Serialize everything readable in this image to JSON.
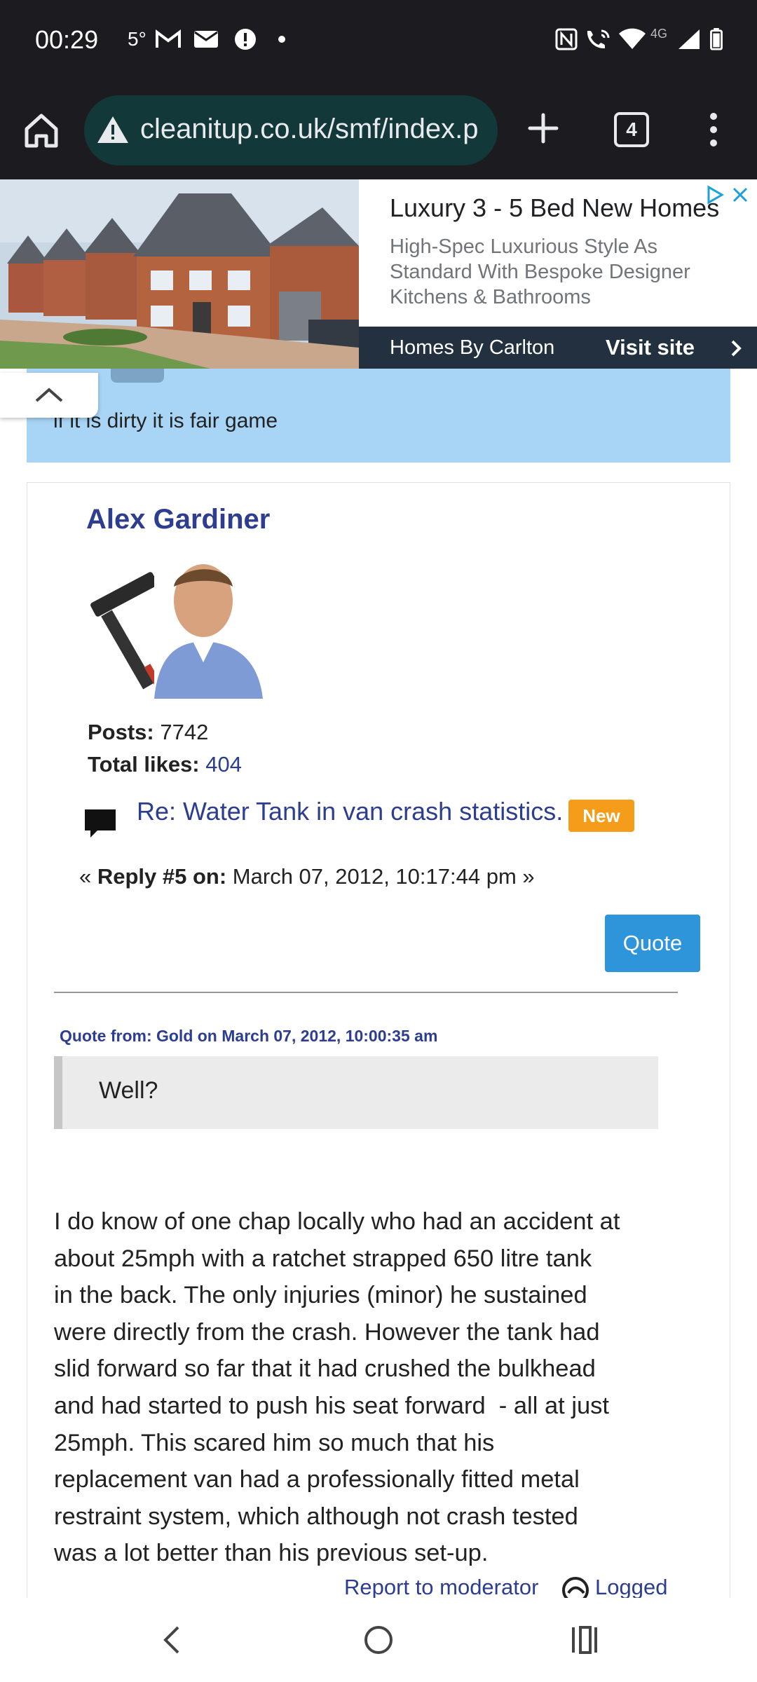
{
  "status_bar": {
    "time": "00:29",
    "temperature": "5°",
    "network": "4G"
  },
  "browser": {
    "url": "cleanitup.co.uk/smf/index.p",
    "tab_count": "4"
  },
  "ad": {
    "title": "Luxury 3 - 5 Bed New Homes",
    "description": "High-Spec Luxurious Style As Standard With Bespoke Designer Kitchens & Bathrooms",
    "advertiser": "Homes By Carlton",
    "cta": "Visit site"
  },
  "signature": {
    "text": "if it is dirty it is fair game"
  },
  "post": {
    "author": "Alex Gardiner",
    "posts_label": "Posts:",
    "posts_value": "7742",
    "likes_label": "Total likes:",
    "likes_value": "404",
    "topic_title": "Re: Water Tank in van crash statistics.",
    "new_badge": "New",
    "reply_prefix": "« ",
    "reply_label": "Reply #5 on:",
    "reply_date": " March 07, 2012, 10:17:44 pm »",
    "quote_button": "Quote",
    "quote_header": "Quote from: Gold on March 07, 2012, 10:00:35 am",
    "quote_text": "Well?",
    "body_lines": [
      "I do know of one chap locally who had an accident at",
      "about 25mph with a ratchet strapped 650 litre tank",
      "in the back. The only injuries (minor) he sustained",
      "were directly from the crash. However the tank had",
      "slid forward so far that it had crushed the bulkhead",
      "and had started to push his seat forward  - all at just",
      "25mph. This scared him so much that his",
      "replacement van had a professionally fitted metal",
      "restraint system, which although not crash tested",
      "was a lot better than his previous set-up."
    ],
    "report_link": "Report to moderator",
    "logged_label": "Logged"
  },
  "colors": {
    "link": "#2d3d8f",
    "quote_button": "#2e95db",
    "new_badge": "#f59d1b",
    "signature_bg": "#a8d4f5"
  }
}
